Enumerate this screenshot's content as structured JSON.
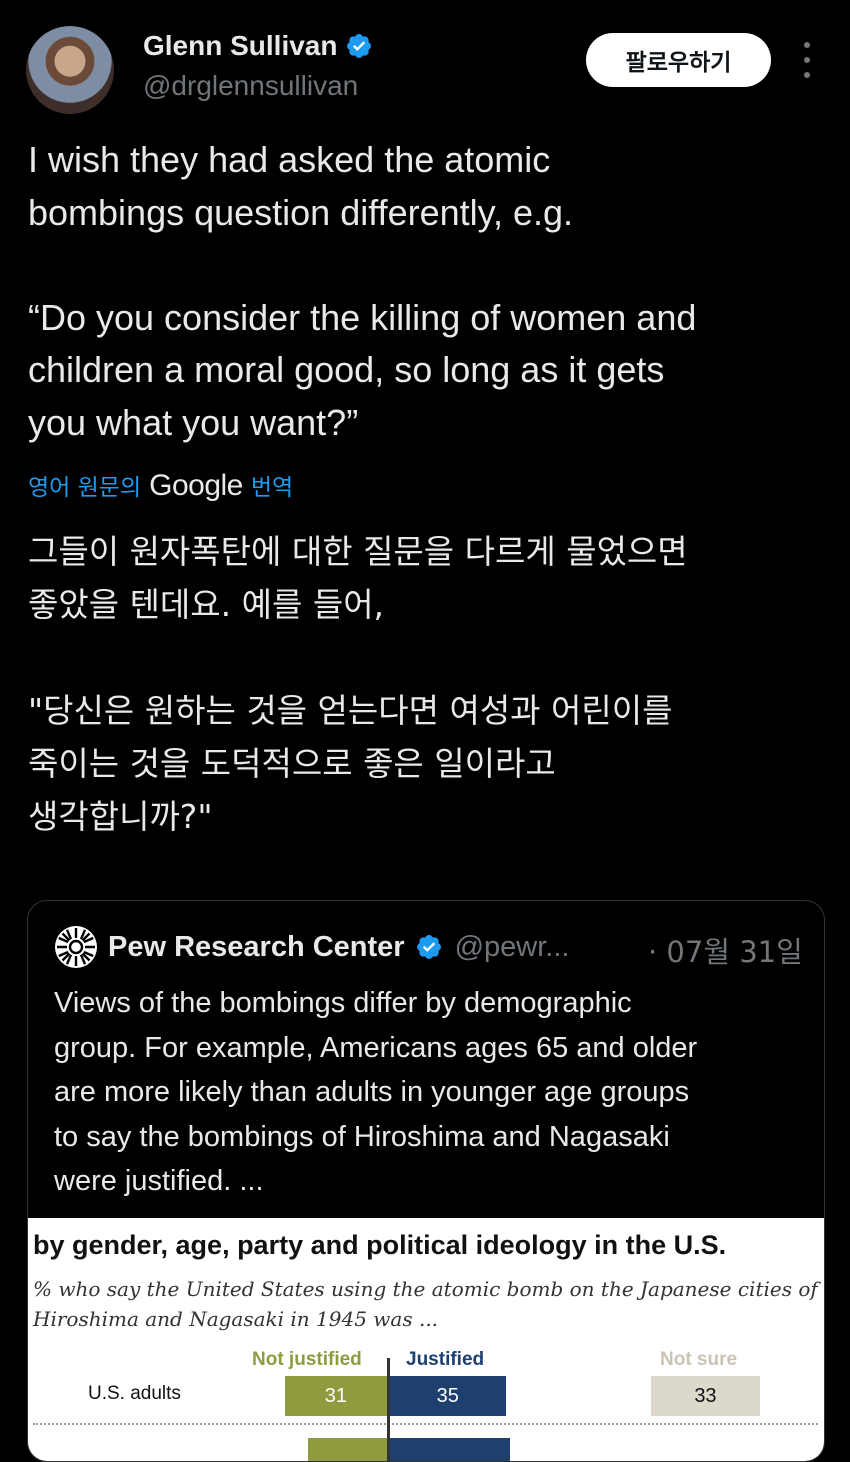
{
  "author": {
    "name": "Glenn Sullivan",
    "handle": "@drglennsullivan"
  },
  "follow_label": "팔로우하기",
  "tweet": {
    "text": "I wish they had asked the atomic\nbombings question differently, e.g.\n\n“Do you consider the killing of women and\nchildren a moral good, so long as it gets\nyou what you want?”",
    "translate_prefix": "영어 원문의",
    "translate_brand": "Google",
    "translate_suffix": "번역",
    "translated": "그들이 원자폭탄에 대한 질문을 다르게 물었으면\n좋았을 텐데요. 예를 들어,\n\n\"당신은 원하는 것을 얻는다면 여성과 어린이를\n죽이는 것을 도덕적으로 좋은 일이라고\n생각합니까?\""
  },
  "quote": {
    "name": "Pew Research Center",
    "handle": "@pewr...",
    "date": "· 07월 31일",
    "text": "Views of the bombings differ by demographic\ngroup. For example, Americans ages 65 and older\nare more likely than adults in younger age groups\nto say the bombings of Hiroshima and Nagasaki\nwere justified. ..."
  },
  "chart_data": {
    "type": "bar",
    "title": "by gender, age, party and political ideology in the U.S.",
    "subtitle": "% who say the United States using the atomic bomb on the Japanese cities of\nHiroshima and Nagasaki in 1945 was ...",
    "categories": [
      "U.S. adults"
    ],
    "series": [
      {
        "name": "Not justified",
        "values": [
          31
        ],
        "color": "#8f9b3e"
      },
      {
        "name": "Justified",
        "values": [
          35
        ],
        "color": "#1f3f6e"
      },
      {
        "name": "Not sure",
        "values": [
          33
        ],
        "color": "#dcd8cc"
      }
    ]
  },
  "icons": {
    "verified": "verified-badge-icon",
    "more": "more-vertical-icon",
    "pew_logo": "pew-logo-icon"
  },
  "colors": {
    "background": "#000000",
    "link": "#1d9bf0",
    "verified": "#1d9bf0",
    "muted": "#71767b"
  }
}
